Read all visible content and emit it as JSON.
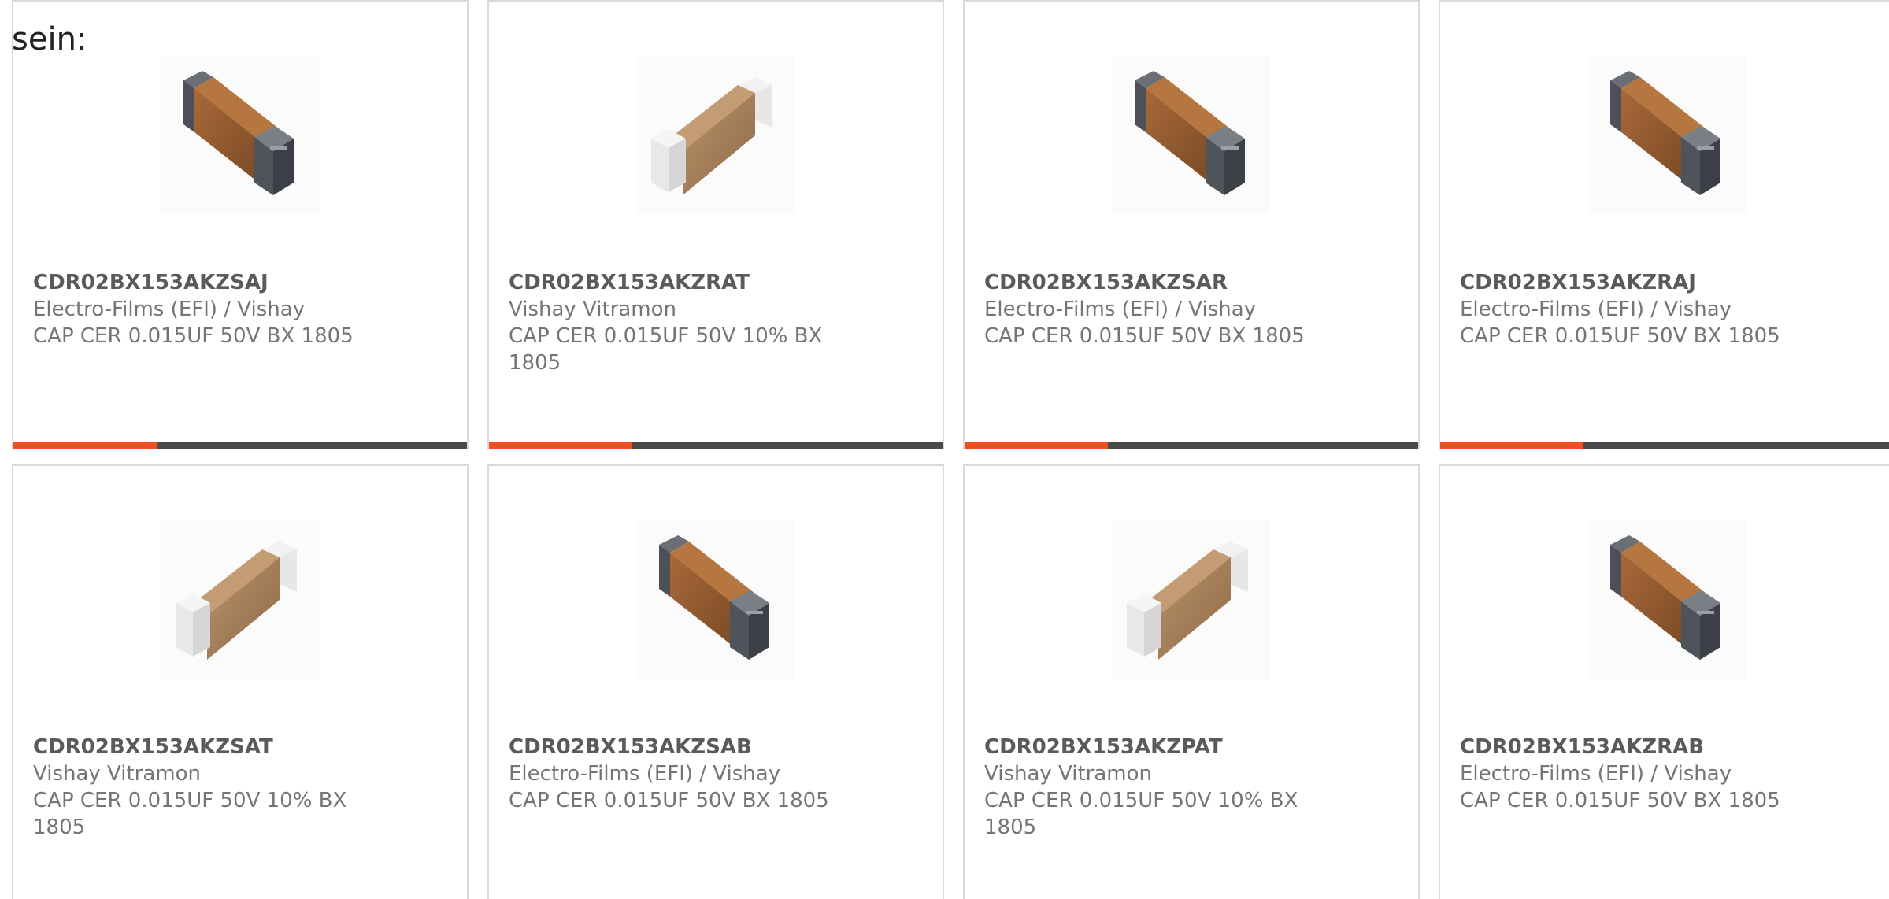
{
  "intro_text": "sein:",
  "colors": {
    "accent": "#f04e23",
    "bar_dark": "#4a4a4a",
    "card_border": "#d9d9d9"
  },
  "products": [
    {
      "part_number": "CDR02BX153AKZSAJ",
      "manufacturer": "Electro-Films (EFI) / Vishay",
      "description": "CAP CER 0.015UF 50V BX 1805",
      "image": "mlcc-capacitor-dark-terminal-icon"
    },
    {
      "part_number": "CDR02BX153AKZRAT",
      "manufacturer": "Vishay Vitramon",
      "description": "CAP CER 0.015UF 50V 10% BX 1805",
      "image": "mlcc-capacitor-light-terminal-icon"
    },
    {
      "part_number": "CDR02BX153AKZSAR",
      "manufacturer": "Electro-Films (EFI) / Vishay",
      "description": "CAP CER 0.015UF 50V BX 1805",
      "image": "mlcc-capacitor-dark-terminal-icon"
    },
    {
      "part_number": "CDR02BX153AKZRAJ",
      "manufacturer": "Electro-Films (EFI) / Vishay",
      "description": "CAP CER 0.015UF 50V BX 1805",
      "image": "mlcc-capacitor-dark-terminal-icon"
    },
    {
      "part_number": "CDR02BX153AKZSAT",
      "manufacturer": "Vishay Vitramon",
      "description": "CAP CER 0.015UF 50V 10% BX 1805",
      "image": "mlcc-capacitor-light-terminal-icon"
    },
    {
      "part_number": "CDR02BX153AKZSAB",
      "manufacturer": "Electro-Films (EFI) / Vishay",
      "description": "CAP CER 0.015UF 50V BX 1805",
      "image": "mlcc-capacitor-dark-terminal-icon"
    },
    {
      "part_number": "CDR02BX153AKZPAT",
      "manufacturer": "Vishay Vitramon",
      "description": "CAP CER 0.015UF 50V 10% BX 1805",
      "image": "mlcc-capacitor-light-terminal-icon"
    },
    {
      "part_number": "CDR02BX153AKZRAB",
      "manufacturer": "Electro-Films (EFI) / Vishay",
      "description": "CAP CER 0.015UF 50V BX 1805",
      "image": "mlcc-capacitor-dark-terminal-icon"
    }
  ]
}
